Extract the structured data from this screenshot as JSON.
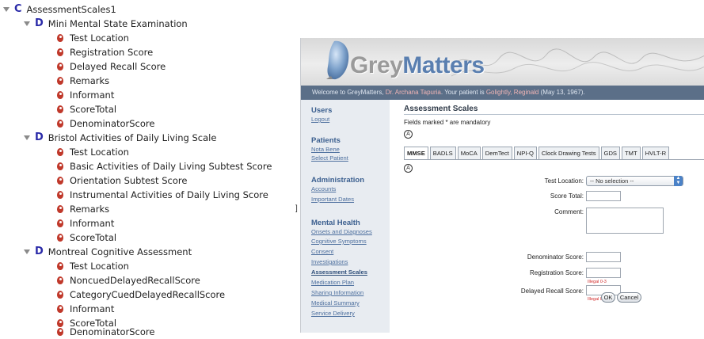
{
  "tree": {
    "root": {
      "badge": "C",
      "label": "AssessmentScales1"
    },
    "groups": [
      {
        "badge": "D",
        "label": "Mini Mental State Examination",
        "items": [
          "Test Location",
          "Registration Score",
          "Delayed Recall Score",
          "Remarks",
          "Informant",
          "ScoreTotal",
          "DenominatorScore"
        ]
      },
      {
        "badge": "D",
        "label": "Bristol Activities of Daily Living Scale",
        "items": [
          "Test Location",
          "Basic Activities of Daily Living Subtest Score",
          "Orientation Subtest Score",
          "Instrumental Activities of Daily Living Score",
          "Remarks",
          "Informant",
          "ScoreTotal"
        ]
      },
      {
        "badge": "D",
        "label": "Montreal Cognitive Assessment",
        "items": [
          "Test Location",
          "NoncuedDelayedRecallScore",
          "CategoryCuedDelayedRecallScore",
          "Informant",
          "ScoreTotal",
          "DenominatorScore"
        ]
      }
    ],
    "stray_char": "]"
  },
  "app": {
    "logo": {
      "part1": "Grey",
      "part2": "Matters"
    },
    "welcome": {
      "prefix": "Welcome to GreyMatters, ",
      "user": "Dr. Archana Tapuria",
      "mid": ". Your patient is ",
      "patient": "Golightly, Reginald",
      "suffix": " (May 13, 1967)."
    },
    "nav": {
      "users": {
        "heading": "Users",
        "links": [
          "Logout"
        ]
      },
      "patients": {
        "heading": "Patients",
        "links": [
          "Nota Bene",
          "Select Patient"
        ]
      },
      "administration": {
        "heading": "Administration",
        "links": [
          "Accounts",
          "Important Dates"
        ]
      },
      "mental_health": {
        "heading": "Mental Health",
        "links": [
          "Onsets and Diagnoses",
          "Cognitive Symptoms",
          "Consent",
          "Investigations",
          "Assessment Scales",
          "Medication Plan",
          "Sharing Information",
          "Medical Summary",
          "Service Delivery"
        ]
      }
    },
    "content": {
      "title": "Assessment Scales",
      "mandatory_note": "Fields marked * are mandatory",
      "collapse_glyph": "A",
      "tabs": [
        "MMSE",
        "BADLS",
        "MoCA",
        "DemTect",
        "NPI-Q",
        "Clock Drawing Tests",
        "GDS",
        "TMT",
        "HVLT-R"
      ],
      "selected_tab": "MMSE",
      "form": {
        "test_location_label": "Test Location:",
        "test_location_value": "-- No selection --",
        "score_total_label": "Score Total:",
        "comment_label": "Comment:",
        "denominator_label": "Denominator Score:",
        "registration_label": "Registration Score:",
        "registration_error": "Illegal 0-3",
        "delayed_label": "Delayed Recall Score:",
        "delayed_error": "Illegal 0-3"
      },
      "buttons": {
        "ok": "OK",
        "cancel": "Cancel"
      }
    }
  },
  "colors": {
    "badge": "#2a2aa8",
    "leaf": "#c0392b",
    "nav_link": "#4d6f9e",
    "welcome_bar": "#5b6f88",
    "error": "#d12b2b"
  }
}
